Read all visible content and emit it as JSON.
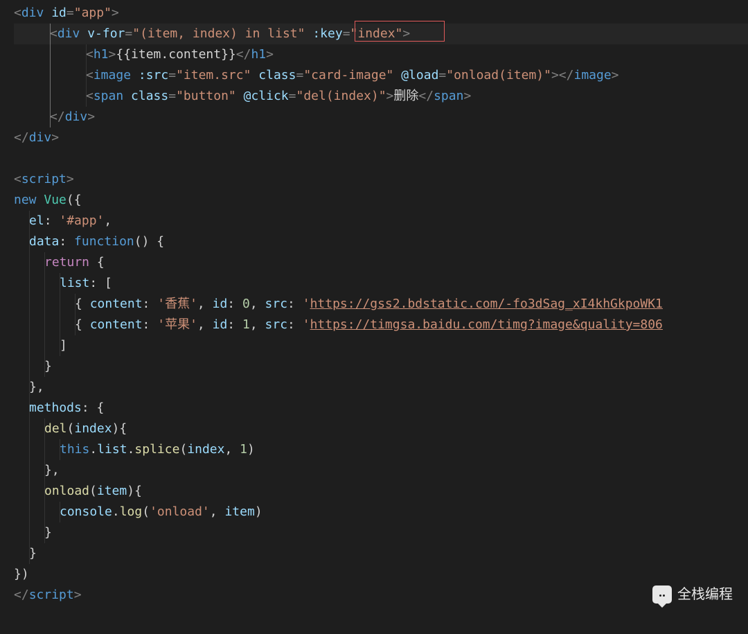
{
  "watermark": "全栈编程",
  "highlight_box": {
    "line": 2,
    "text": ":key=\"index\""
  },
  "code_lines": [
    {
      "indent": 0,
      "tokens": [
        [
          "punc",
          "<"
        ],
        [
          "tag",
          "div"
        ],
        [
          "txt",
          " "
        ],
        [
          "attr",
          "id"
        ],
        [
          "punc",
          "="
        ],
        [
          "str",
          "\"app\""
        ],
        [
          "punc",
          ">"
        ]
      ]
    },
    {
      "indent": 2,
      "hl": true,
      "tokens": [
        [
          "punc",
          "<"
        ],
        [
          "tag",
          "div"
        ],
        [
          "txt",
          " "
        ],
        [
          "attr",
          "v-for"
        ],
        [
          "punc",
          "="
        ],
        [
          "str",
          "\"(item, index) in list\""
        ],
        [
          "txt",
          " "
        ],
        [
          "attr",
          ":key"
        ],
        [
          "punc",
          "="
        ],
        [
          "str",
          "\"index\""
        ],
        [
          "punc",
          ">"
        ]
      ]
    },
    {
      "indent": 4,
      "tokens": [
        [
          "punc",
          "<"
        ],
        [
          "tag",
          "h1"
        ],
        [
          "punc",
          ">"
        ],
        [
          "txt",
          "{{item.content}}"
        ],
        [
          "punc",
          "</"
        ],
        [
          "tag",
          "h1"
        ],
        [
          "punc",
          ">"
        ]
      ]
    },
    {
      "indent": 4,
      "tokens": [
        [
          "punc",
          "<"
        ],
        [
          "tag",
          "image"
        ],
        [
          "txt",
          " "
        ],
        [
          "attr",
          ":src"
        ],
        [
          "punc",
          "="
        ],
        [
          "str",
          "\"item.src\""
        ],
        [
          "txt",
          " "
        ],
        [
          "attr",
          "class"
        ],
        [
          "punc",
          "="
        ],
        [
          "str",
          "\"card-image\""
        ],
        [
          "txt",
          " "
        ],
        [
          "attr",
          "@load"
        ],
        [
          "punc",
          "="
        ],
        [
          "str",
          "\"onload(item)\""
        ],
        [
          "punc",
          "></"
        ],
        [
          "tag",
          "image"
        ],
        [
          "punc",
          ">"
        ]
      ]
    },
    {
      "indent": 4,
      "tokens": [
        [
          "punc",
          "<"
        ],
        [
          "tag",
          "span"
        ],
        [
          "txt",
          " "
        ],
        [
          "attr",
          "class"
        ],
        [
          "punc",
          "="
        ],
        [
          "str",
          "\"button\""
        ],
        [
          "txt",
          " "
        ],
        [
          "attr",
          "@click"
        ],
        [
          "punc",
          "="
        ],
        [
          "str",
          "\"del(index)\""
        ],
        [
          "punc",
          ">"
        ],
        [
          "txt",
          "删除"
        ],
        [
          "punc",
          "</"
        ],
        [
          "tag",
          "span"
        ],
        [
          "punc",
          ">"
        ]
      ]
    },
    {
      "indent": 2,
      "tokens": [
        [
          "punc",
          "</"
        ],
        [
          "tag",
          "div"
        ],
        [
          "punc",
          ">"
        ]
      ]
    },
    {
      "indent": 0,
      "tokens": [
        [
          "punc",
          "</"
        ],
        [
          "tag",
          "div"
        ],
        [
          "punc",
          ">"
        ]
      ]
    },
    {
      "indent": 0,
      "tokens": []
    },
    {
      "indent": 0,
      "tokens": [
        [
          "punc",
          "<"
        ],
        [
          "tag",
          "script"
        ],
        [
          "punc",
          ">"
        ]
      ]
    },
    {
      "indent": 0,
      "tokens": [
        [
          "new",
          "new"
        ],
        [
          "txt",
          " "
        ],
        [
          "cls",
          "Vue"
        ],
        [
          "txt",
          "({"
        ]
      ]
    },
    {
      "indent": 1,
      "tokens": [
        [
          "prop",
          "el"
        ],
        [
          "txt",
          ": "
        ],
        [
          "str",
          "'#app'"
        ],
        [
          "txt",
          ","
        ]
      ]
    },
    {
      "indent": 1,
      "tokens": [
        [
          "prop",
          "data"
        ],
        [
          "txt",
          ": "
        ],
        [
          "kw",
          "function"
        ],
        [
          "txt",
          "() {"
        ]
      ]
    },
    {
      "indent": 2,
      "tokens": [
        [
          "kw2",
          "return"
        ],
        [
          "txt",
          " {"
        ]
      ]
    },
    {
      "indent": 3,
      "tokens": [
        [
          "prop",
          "list"
        ],
        [
          "txt",
          ": ["
        ]
      ]
    },
    {
      "indent": 4,
      "tokens": [
        [
          "txt",
          "{ "
        ],
        [
          "prop",
          "content"
        ],
        [
          "txt",
          ": "
        ],
        [
          "str",
          "'香蕉'"
        ],
        [
          "txt",
          ", "
        ],
        [
          "prop",
          "id"
        ],
        [
          "txt",
          ": "
        ],
        [
          "num",
          "0"
        ],
        [
          "txt",
          ", "
        ],
        [
          "prop",
          "src"
        ],
        [
          "txt",
          ": "
        ],
        [
          "str",
          "'"
        ],
        [
          "link",
          "https://gss2.bdstatic.com/-fo3dSag_xI4khGkpoWK1"
        ]
      ]
    },
    {
      "indent": 4,
      "tokens": [
        [
          "txt",
          "{ "
        ],
        [
          "prop",
          "content"
        ],
        [
          "txt",
          ": "
        ],
        [
          "str",
          "'苹果'"
        ],
        [
          "txt",
          ", "
        ],
        [
          "prop",
          "id"
        ],
        [
          "txt",
          ": "
        ],
        [
          "num",
          "1"
        ],
        [
          "txt",
          ", "
        ],
        [
          "prop",
          "src"
        ],
        [
          "txt",
          ": "
        ],
        [
          "str",
          "'"
        ],
        [
          "link",
          "https://timgsa.baidu.com/timg?image&quality=806"
        ]
      ]
    },
    {
      "indent": 3,
      "tokens": [
        [
          "txt",
          "]"
        ]
      ]
    },
    {
      "indent": 2,
      "tokens": [
        [
          "txt",
          "}"
        ]
      ]
    },
    {
      "indent": 1,
      "tokens": [
        [
          "txt",
          "},"
        ]
      ]
    },
    {
      "indent": 1,
      "tokens": [
        [
          "prop",
          "methods"
        ],
        [
          "txt",
          ": {"
        ]
      ]
    },
    {
      "indent": 2,
      "tokens": [
        [
          "fn",
          "del"
        ],
        [
          "txt",
          "("
        ],
        [
          "prop",
          "index"
        ],
        [
          "txt",
          "){"
        ]
      ]
    },
    {
      "indent": 3,
      "tokens": [
        [
          "this",
          "this"
        ],
        [
          "txt",
          "."
        ],
        [
          "prop",
          "list"
        ],
        [
          "txt",
          "."
        ],
        [
          "fn",
          "splice"
        ],
        [
          "txt",
          "("
        ],
        [
          "prop",
          "index"
        ],
        [
          "txt",
          ", "
        ],
        [
          "num",
          "1"
        ],
        [
          "txt",
          ")"
        ]
      ]
    },
    {
      "indent": 2,
      "tokens": [
        [
          "txt",
          "},"
        ]
      ]
    },
    {
      "indent": 2,
      "tokens": [
        [
          "fn",
          "onload"
        ],
        [
          "txt",
          "("
        ],
        [
          "prop",
          "item"
        ],
        [
          "txt",
          "){"
        ]
      ]
    },
    {
      "indent": 3,
      "tokens": [
        [
          "prop",
          "console"
        ],
        [
          "txt",
          "."
        ],
        [
          "fn",
          "log"
        ],
        [
          "txt",
          "("
        ],
        [
          "str",
          "'onload'"
        ],
        [
          "txt",
          ", "
        ],
        [
          "prop",
          "item"
        ],
        [
          "txt",
          ")"
        ]
      ]
    },
    {
      "indent": 2,
      "tokens": [
        [
          "txt",
          "}"
        ]
      ]
    },
    {
      "indent": 1,
      "tokens": [
        [
          "txt",
          "}"
        ]
      ]
    },
    {
      "indent": 0,
      "tokens": [
        [
          "txt",
          "})"
        ]
      ]
    },
    {
      "indent": 0,
      "tokens": [
        [
          "punc",
          "</"
        ],
        [
          "tag",
          "script"
        ],
        [
          "punc",
          ">"
        ]
      ]
    }
  ],
  "indent_guides": {
    "0": [],
    "1": [
      2
    ],
    "2": [
      2,
      4
    ],
    "3": [
      2,
      4
    ],
    "4": [
      2,
      4
    ],
    "5": [
      2
    ],
    "6": [],
    "7": [],
    "8": [],
    "9": [],
    "10": [
      1
    ],
    "11": [
      1
    ],
    "12": [
      1,
      2
    ],
    "13": [
      1,
      2,
      3
    ],
    "14": [
      1,
      2,
      3,
      4
    ],
    "15": [
      1,
      2,
      3,
      4
    ],
    "16": [
      1,
      2,
      3
    ],
    "17": [
      1,
      2
    ],
    "18": [
      1
    ],
    "19": [
      1
    ],
    "20": [
      1,
      2
    ],
    "21": [
      1,
      2,
      3
    ],
    "22": [
      1,
      2
    ],
    "23": [
      1,
      2
    ],
    "24": [
      1,
      2,
      3
    ],
    "25": [
      1,
      2
    ],
    "26": [
      1
    ],
    "27": [],
    "28": []
  }
}
